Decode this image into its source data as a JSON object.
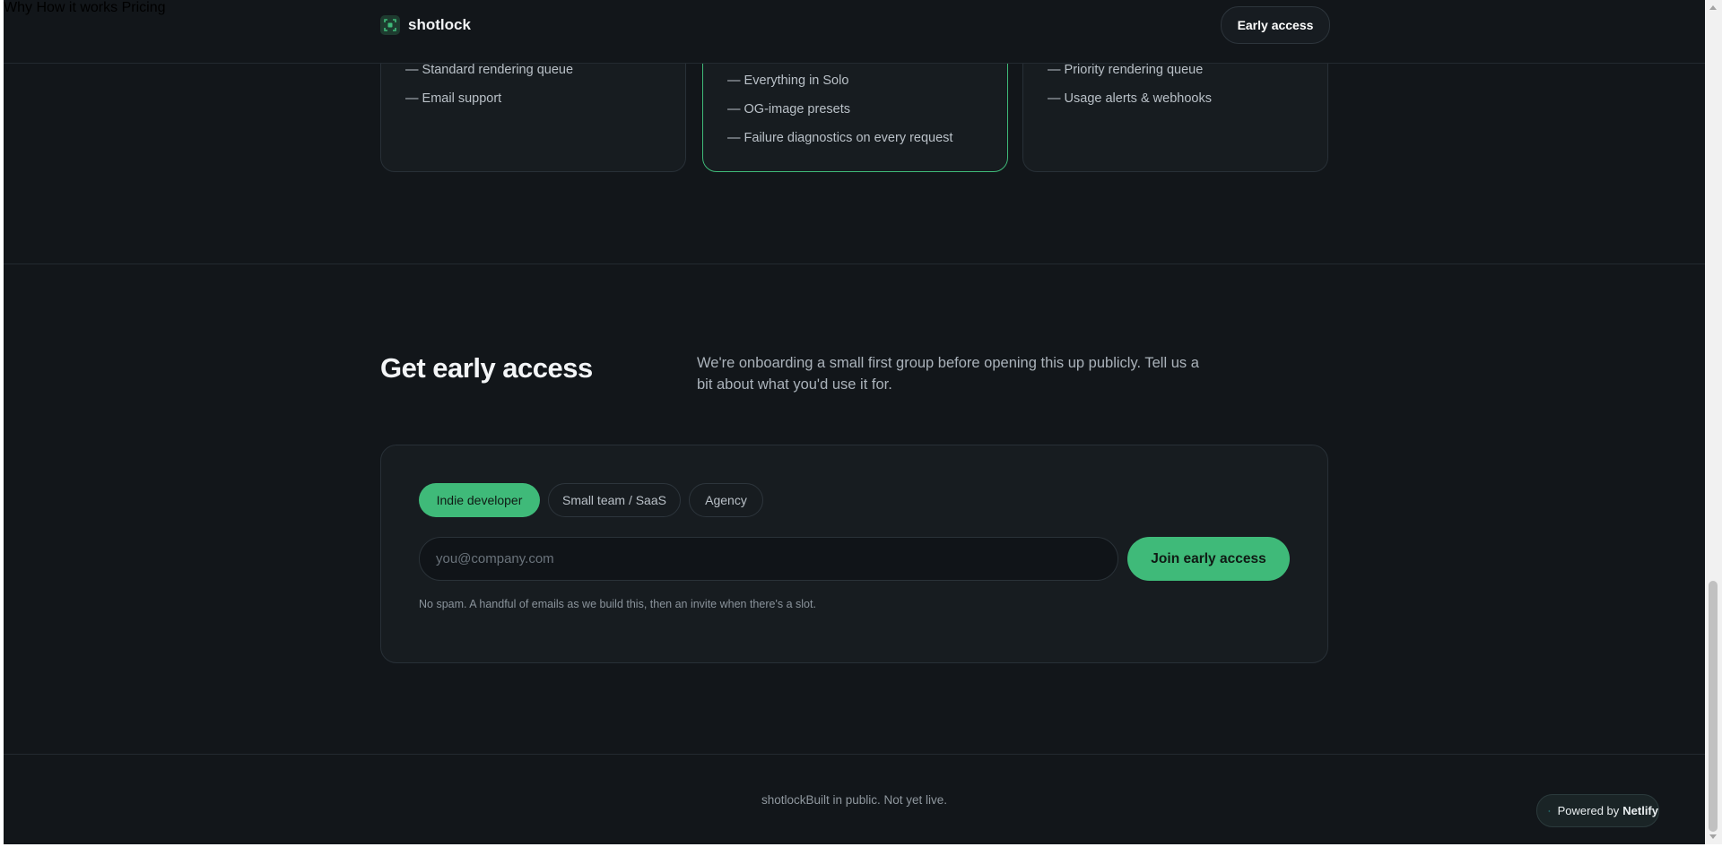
{
  "header": {
    "brand": "shotlock",
    "nav": [
      "Why",
      "How it works",
      "Pricing"
    ],
    "cta": "Early access"
  },
  "pricing": {
    "cards": [
      {
        "features": [
          "— Standard rendering queue",
          "— Email support"
        ]
      },
      {
        "features": [
          "— Everything in Solo",
          "— OG-image presets",
          "— Failure diagnostics on every request"
        ]
      },
      {
        "features": [
          "— Priority rendering queue",
          "— Usage alerts & webhooks"
        ]
      }
    ]
  },
  "early_access": {
    "title": "Get early access",
    "description": "We're onboarding a small first group before opening this up publicly. Tell us a bit about what you'd use it for.",
    "segments": [
      "Indie developer",
      "Small team / SaaS",
      "Agency"
    ],
    "selected_segment": "Indie developer",
    "email_placeholder": "you@company.com",
    "email_value": "",
    "submit": "Join early access",
    "note": "No spam. A handful of emails as we build this, then an invite when there's a slot."
  },
  "footer": {
    "text": "shotlockBuilt in public. Not yet live."
  },
  "badge": {
    "prefix": "Powered by",
    "name": "Netlify"
  },
  "colors": {
    "background": "#12161a",
    "accent": "#3fba79",
    "card": "#171c20"
  }
}
